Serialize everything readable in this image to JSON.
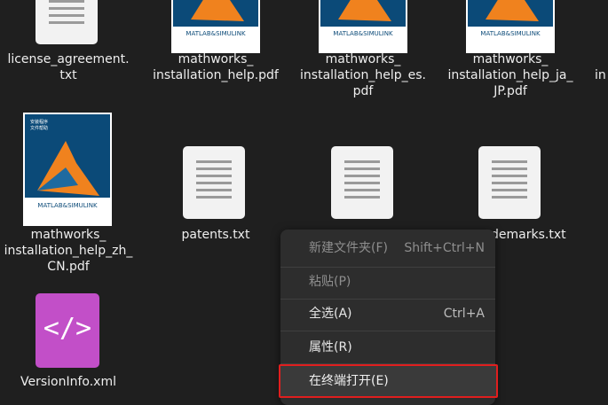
{
  "files": [
    {
      "name": "license_agreement.\ntxt",
      "type": "txt"
    },
    {
      "name": "mathworks_\ninstallation_help.pdf",
      "type": "pdf"
    },
    {
      "name": "mathworks_\ninstallation_help_es.\npdf",
      "type": "pdf"
    },
    {
      "name": "mathworks_\ninstallation_help_ja_\nJP.pdf",
      "type": "pdf"
    },
    {
      "name": "in",
      "type": "partial"
    },
    {
      "name": "mathworks_\ninstallation_help_zh_\nCN.pdf",
      "type": "pdf"
    },
    {
      "name": "patents.txt",
      "type": "txt"
    },
    {
      "name": "",
      "type": "txt"
    },
    {
      "name": "demarks.txt",
      "type": "txt"
    },
    {
      "name": "VersionInfo.xml",
      "type": "xml"
    }
  ],
  "pdf_cover": {
    "brand": "MATLAB&SIMULINK",
    "zh_title_line1": "安装程序",
    "zh_title_line2": "文件帮助"
  },
  "xml_icon_glyph": "</>",
  "context_menu": {
    "items": [
      {
        "label": "新建文件夹(F)",
        "accel": "Shift+Ctrl+N",
        "enabled": false
      },
      {
        "label": "粘贴(P)",
        "accel": "",
        "enabled": false
      },
      {
        "label": "全选(A)",
        "accel": "Ctrl+A",
        "enabled": true
      },
      {
        "label": "属性(R)",
        "accel": "",
        "enabled": true
      },
      {
        "label": "在终端打开(E)",
        "accel": "",
        "enabled": true,
        "highlighted": true
      }
    ]
  },
  "colors": {
    "background": "#1f1f1f",
    "menu_bg": "#2d2d2d",
    "highlight_border": "#e01e1e",
    "xml_icon": "#c24fc8"
  }
}
